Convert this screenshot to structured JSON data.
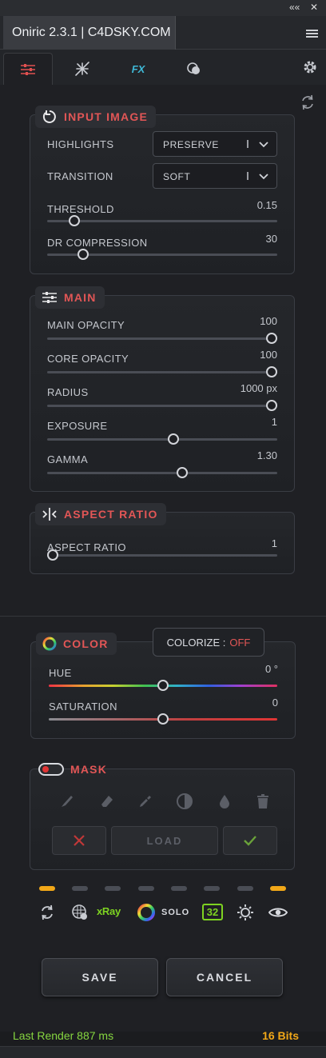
{
  "window": {
    "title": "Oniric 2.3.1 | C4DSKY.COM",
    "collapse_glyph": "««",
    "close_glyph": "✕"
  },
  "tabs": [
    {
      "name": "sliders-icon",
      "active": true
    },
    {
      "name": "star-burst-icon",
      "active": false
    },
    {
      "name": "fx-icon",
      "label": "FX",
      "active": false
    },
    {
      "name": "circles-icon",
      "active": false
    }
  ],
  "input_image": {
    "title": "INPUT IMAGE",
    "highlights": {
      "label": "HIGHLIGHTS",
      "value": "PRESERVE"
    },
    "transition": {
      "label": "TRANSITION",
      "value": "SOFT"
    },
    "threshold": {
      "label": "THRESHOLD",
      "value": "0.15",
      "level": 0.1
    },
    "dr_compression": {
      "label": "DR COMPRESSION",
      "value": "30",
      "level": 0.14
    }
  },
  "main": {
    "title": "MAIN",
    "main_opacity": {
      "label": "MAIN OPACITY",
      "value": "100",
      "level": 1.0
    },
    "core_opacity": {
      "label": "CORE OPACITY",
      "value": "100",
      "level": 1.0
    },
    "radius": {
      "label": "RADIUS",
      "value": "1000 px",
      "level": 1.0
    },
    "exposure": {
      "label": "EXPOSURE",
      "value": "1",
      "level": 0.55
    },
    "gamma": {
      "label": "GAMMA",
      "value": "1.30",
      "level": 0.59
    }
  },
  "aspect_ratio": {
    "title": "ASPECT RATIO",
    "aspect": {
      "label": "ASPECT RATIO",
      "value": "1",
      "level": 0.0
    }
  },
  "color": {
    "title": "COLOR",
    "colorize_label": "COLORIZE :",
    "colorize_state": "OFF",
    "hue": {
      "label": "HUE",
      "value": "0 °",
      "level": 0.5
    },
    "saturation": {
      "label": "SATURATION",
      "value": "0",
      "level": 0.5
    }
  },
  "mask": {
    "title": "MASK",
    "load_label": "LOAD",
    "tools": [
      "brush-icon",
      "eraser-icon",
      "eyedropper-icon",
      "contrast-icon",
      "drop-icon",
      "trash-icon"
    ]
  },
  "toolbar": {
    "indicators": [
      true,
      false,
      false,
      false,
      false,
      false,
      false,
      true
    ],
    "xray_label": "xRay",
    "solo_label": "SOLO",
    "bits_badge": "32"
  },
  "actions": {
    "save": "SAVE",
    "cancel": "CANCEL"
  },
  "status": {
    "last_render": "Last Render 887 ms",
    "bits": "16 Bits"
  },
  "colors": {
    "accent_red": "#e25656",
    "render_green": "#86d640",
    "bits_orange": "#f2a818",
    "indicator_on": "#f2a818",
    "xray_green": "#7ed321"
  }
}
